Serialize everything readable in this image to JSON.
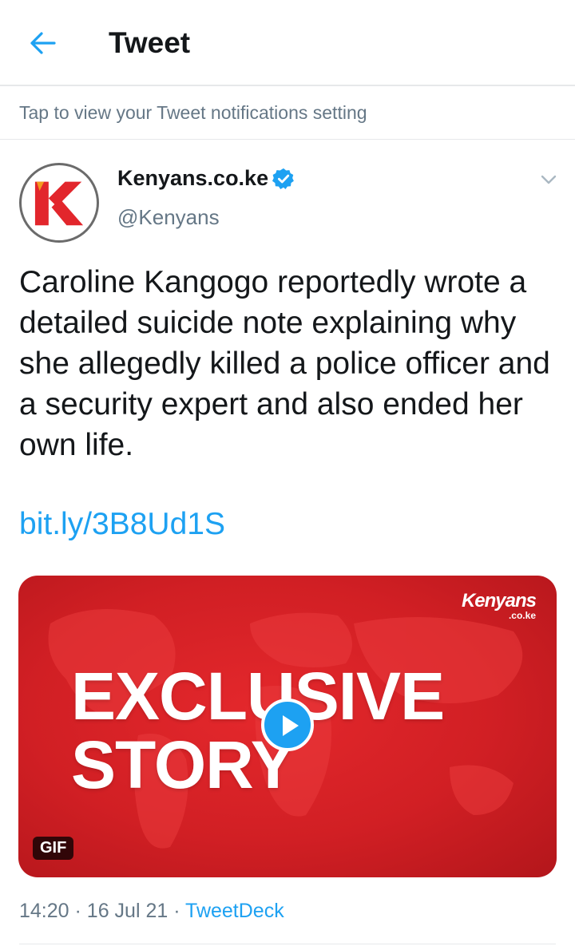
{
  "header": {
    "title": "Tweet",
    "back_icon": "back-arrow-icon"
  },
  "notice": {
    "text": "Tap to view your Tweet notifications setting"
  },
  "tweet": {
    "author_name": "Kenyans.co.ke",
    "author_handle": "@Kenyans",
    "verified": true,
    "text": "Caroline Kangogo reportedly wrote a detailed suicide note explaining why she allegedly killed a police officer and a security expert and also ended her own life.",
    "link": "bit.ly/3B8Ud1S",
    "media": {
      "brand_line1": "Kenyans",
      "brand_line2": ".co.ke",
      "headline_line1": "EXCLUSIVE",
      "headline_line2": "STORY",
      "badge": "GIF",
      "play_icon": "play-icon"
    },
    "time": "14:20",
    "date": "16 Jul 21",
    "separator": "·",
    "source": "TweetDeck"
  },
  "colors": {
    "accent": "#1da1f2",
    "secondary_text": "#657786",
    "media_red": "#d11f24"
  }
}
